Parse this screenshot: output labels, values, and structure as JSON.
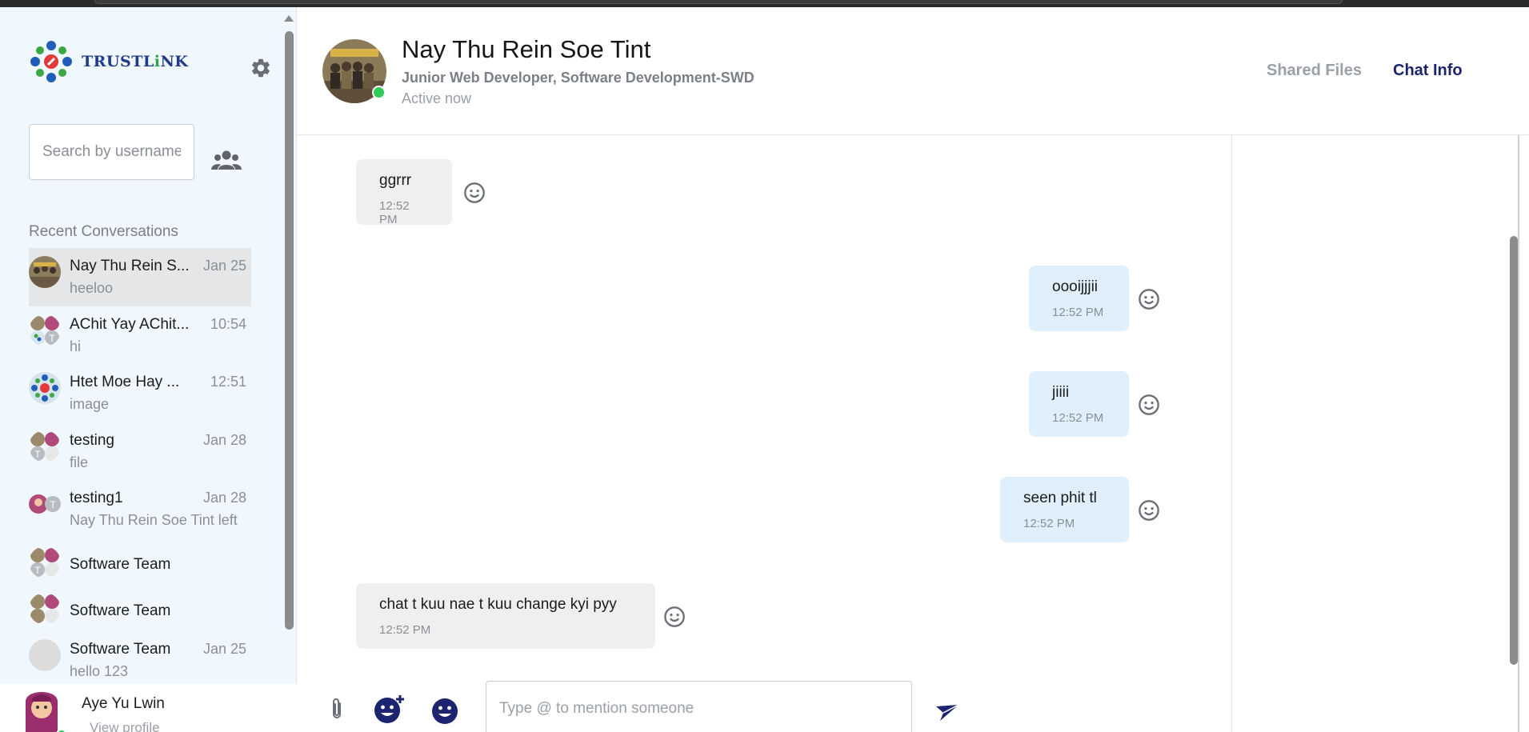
{
  "sidebar": {
    "logo_text_a": "TRUSTL",
    "logo_text_b": "i",
    "logo_text_c": "NK",
    "search_placeholder": "Search by username",
    "recent_title": "Recent Conversations",
    "conversations": [
      {
        "name": "Nay Thu Rein S...",
        "date": "Jan 25",
        "preview": "heeloo"
      },
      {
        "name": "AChit Yay AChit...",
        "date": "10:54",
        "preview": "hi"
      },
      {
        "name": "Htet Moe Hay ...",
        "date": "12:51",
        "preview": "image"
      },
      {
        "name": "testing",
        "date": "Jan 28",
        "preview": "file"
      },
      {
        "name": "testing1",
        "date": "Jan 28",
        "preview": "Nay Thu Rein Soe Tint left"
      },
      {
        "name": "Software Team",
        "date": "",
        "preview": ""
      },
      {
        "name": "Software Team",
        "date": "",
        "preview": ""
      },
      {
        "name": "Software Team",
        "date": "Jan 25",
        "preview": "hello 123"
      }
    ],
    "profile": {
      "name": "Aye Yu Lwin",
      "link": "View profile"
    }
  },
  "header": {
    "name": "Nay Thu Rein Soe Tint",
    "role": "Junior Web Developer, Software Development-SWD",
    "status": "Active now",
    "tabs": {
      "shared": "Shared Files",
      "info": "Chat Info"
    }
  },
  "messages": [
    {
      "text": "ggrrr",
      "time": "12:52 PM",
      "direction": "in"
    },
    {
      "text": "oooijjjii",
      "time": "12:52 PM",
      "direction": "out"
    },
    {
      "text": "jiiii",
      "time": "12:52 PM",
      "direction": "out"
    },
    {
      "text": "seen phit tl",
      "time": "12:52 PM",
      "direction": "out"
    },
    {
      "text": "chat t kuu nae t kuu change kyi pyy",
      "time": "12:52 PM",
      "direction": "in"
    }
  ],
  "composer": {
    "placeholder": "Type @ to mention someone"
  },
  "colors": {
    "sidebar_bg": "#f0f8fe",
    "incoming_bubble": "#efefef",
    "outgoing_bubble": "#dff0fc",
    "accent_navy": "#1c2470",
    "online_green": "#2ecc58"
  },
  "icons": [
    "gear-icon",
    "group-icon",
    "attach-icon",
    "sticker-icon",
    "emoji-icon",
    "send-icon",
    "reaction-icon"
  ]
}
